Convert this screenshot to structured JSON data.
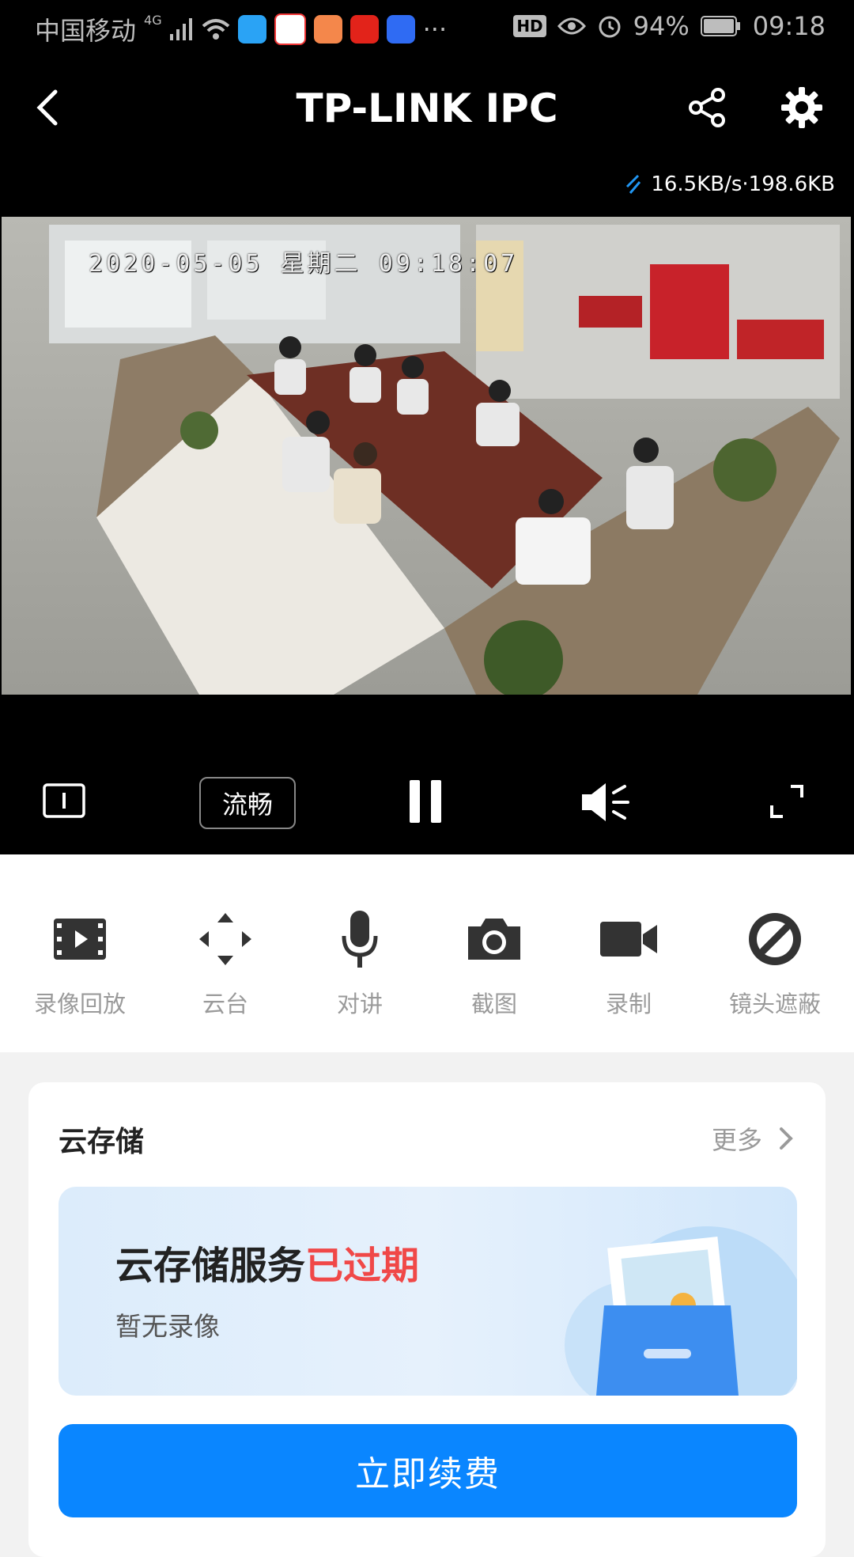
{
  "status_bar": {
    "carrier": "中国移动",
    "network": "4G",
    "more": "···",
    "hd_badge": "HD",
    "battery": "94%",
    "time": "09:18"
  },
  "header": {
    "title": "TP-LINK IPC"
  },
  "stream": {
    "rate": "16.5KB/s·198.6KB",
    "osd_text": "2020-05-05 星期二 09:18:07"
  },
  "controls": {
    "quality_label": "流畅"
  },
  "actions": [
    {
      "label": "录像回放",
      "icon": "film-icon"
    },
    {
      "label": "云台",
      "icon": "pan-tilt-icon"
    },
    {
      "label": "对讲",
      "icon": "microphone-icon"
    },
    {
      "label": "截图",
      "icon": "camera-icon"
    },
    {
      "label": "录制",
      "icon": "video-camera-icon"
    },
    {
      "label": "镜头遮蔽",
      "icon": "lens-block-icon"
    }
  ],
  "cloud": {
    "title": "云存储",
    "more_label": "更多",
    "service_text": "云存储服务",
    "expired_text": "已过期",
    "no_recording": "暂无录像",
    "renew_label": "立即续费"
  },
  "colors": {
    "accent": "#0a86ff",
    "expired": "#f04848",
    "icon_dark": "#333333"
  }
}
